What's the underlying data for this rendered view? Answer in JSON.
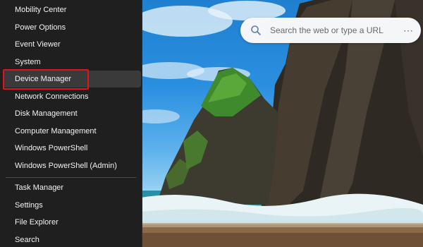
{
  "menu": {
    "items_group1": [
      {
        "label": "Mobility Center",
        "name": "menu-item-mobility-center"
      },
      {
        "label": "Power Options",
        "name": "menu-item-power-options"
      },
      {
        "label": "Event Viewer",
        "name": "menu-item-event-viewer"
      },
      {
        "label": "System",
        "name": "menu-item-system"
      },
      {
        "label": "Device Manager",
        "name": "menu-item-device-manager"
      },
      {
        "label": "Network Connections",
        "name": "menu-item-network-connections"
      },
      {
        "label": "Disk Management",
        "name": "menu-item-disk-management"
      },
      {
        "label": "Computer Management",
        "name": "menu-item-computer-management"
      },
      {
        "label": "Windows PowerShell",
        "name": "menu-item-windows-powershell"
      },
      {
        "label": "Windows PowerShell (Admin)",
        "name": "menu-item-windows-powershell-admin"
      }
    ],
    "items_group2": [
      {
        "label": "Task Manager",
        "name": "menu-item-task-manager"
      },
      {
        "label": "Settings",
        "name": "menu-item-settings"
      },
      {
        "label": "File Explorer",
        "name": "menu-item-file-explorer"
      },
      {
        "label": "Search",
        "name": "menu-item-search"
      }
    ],
    "highlighted_item": "Device Manager",
    "highlight_color": "#e0141c"
  },
  "search": {
    "placeholder": "Search the web or type a URL",
    "more_icon": "more-horizontal-icon"
  }
}
